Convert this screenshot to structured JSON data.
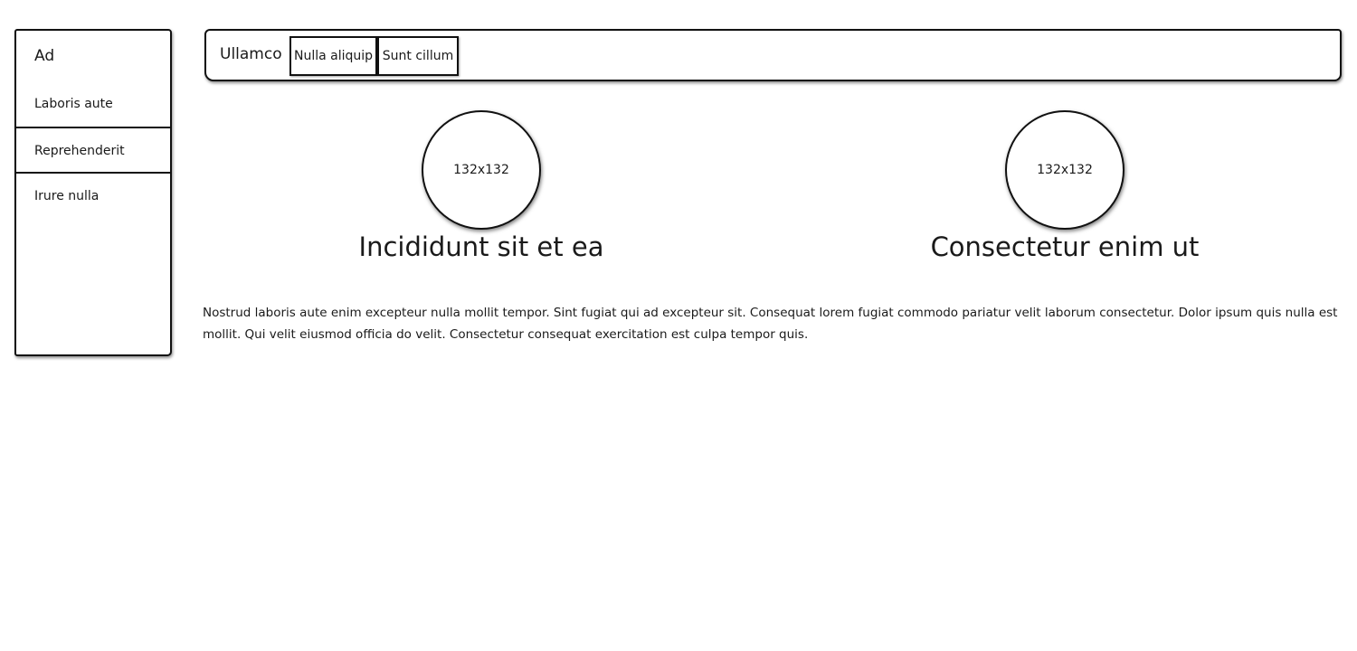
{
  "sidebar": {
    "title": "Ad",
    "items": [
      {
        "label": "Laboris aute"
      },
      {
        "label": "Reprehenderit"
      },
      {
        "label": "Irure nulla"
      }
    ]
  },
  "navbar": {
    "brand": "Ullamco",
    "tabs": [
      {
        "label": "Nulla aliquip"
      },
      {
        "label": "Sunt cillum"
      }
    ]
  },
  "cards": [
    {
      "image_label": "132x132",
      "title": "Incididunt sit et ea"
    },
    {
      "image_label": "132x132",
      "title": "Consectetur enim ut"
    }
  ],
  "paragraph": "Nostrud laboris aute enim excepteur nulla mollit tempor. Sint fugiat qui ad excepteur sit. Consequat lorem fugiat commodo pariatur velit laborum consectetur. Dolor ipsum quis nulla est mollit. Qui velit eiusmod officia do velit. Consectetur consequat exercitation est culpa tempor quis."
}
